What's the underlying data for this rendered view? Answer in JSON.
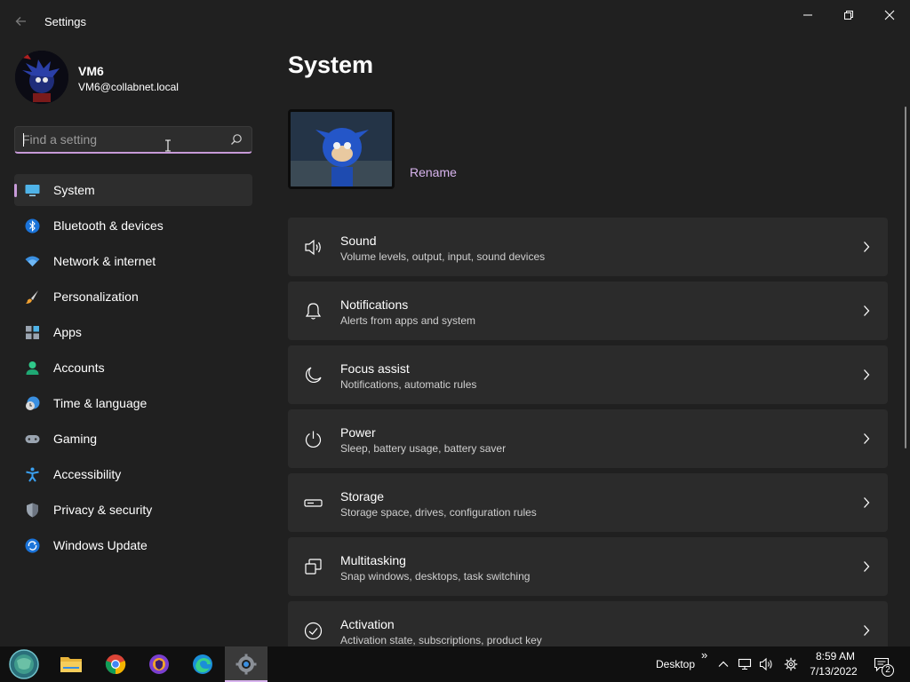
{
  "window": {
    "title": "Settings",
    "controls": [
      "minimize-icon",
      "restore-icon",
      "close-icon"
    ]
  },
  "user": {
    "name": "VM6",
    "email": "VM6@collabnet.local"
  },
  "search": {
    "placeholder": "Find a setting",
    "value": ""
  },
  "sidebar": {
    "items": [
      {
        "label": "System",
        "icon": "monitor-icon",
        "active": true
      },
      {
        "label": "Bluetooth & devices",
        "icon": "bluetooth-icon"
      },
      {
        "label": "Network & internet",
        "icon": "wifi-icon"
      },
      {
        "label": "Personalization",
        "icon": "brush-icon"
      },
      {
        "label": "Apps",
        "icon": "apps-icon"
      },
      {
        "label": "Accounts",
        "icon": "person-icon"
      },
      {
        "label": "Time & language",
        "icon": "clock-globe-icon"
      },
      {
        "label": "Gaming",
        "icon": "gamepad-icon"
      },
      {
        "label": "Accessibility",
        "icon": "accessibility-icon"
      },
      {
        "label": "Privacy & security",
        "icon": "shield-icon"
      },
      {
        "label": "Windows Update",
        "icon": "update-icon"
      }
    ]
  },
  "main": {
    "title": "System",
    "rename_label": "Rename",
    "cards": [
      {
        "title": "Sound",
        "subtitle": "Volume levels, output, input, sound devices",
        "icon": "speaker-icon"
      },
      {
        "title": "Notifications",
        "subtitle": "Alerts from apps and system",
        "icon": "bell-icon"
      },
      {
        "title": "Focus assist",
        "subtitle": "Notifications, automatic rules",
        "icon": "moon-icon"
      },
      {
        "title": "Power",
        "subtitle": "Sleep, battery usage, battery saver",
        "icon": "power-icon"
      },
      {
        "title": "Storage",
        "subtitle": "Storage space, drives, configuration rules",
        "icon": "storage-icon"
      },
      {
        "title": "Multitasking",
        "subtitle": "Snap windows, desktops, task switching",
        "icon": "multitasking-icon"
      },
      {
        "title": "Activation",
        "subtitle": "Activation state, subscriptions, product key",
        "icon": "check-circle-icon"
      }
    ]
  },
  "taskbar": {
    "apps": [
      "start-icon",
      "file-explorer-icon",
      "chrome-icon",
      "brave-icon",
      "edge-icon",
      "settings-icon"
    ],
    "active_app": "settings-icon",
    "desktop_label": "Desktop",
    "overflow_label": "»",
    "time": "8:59 AM",
    "date": "7/13/2022",
    "notification_count": "2"
  },
  "colors": {
    "background": "#202020",
    "card": "#2b2b2b",
    "accent": "#c79ad8",
    "link": "#d8b4ee",
    "taskbar": "#101010"
  }
}
